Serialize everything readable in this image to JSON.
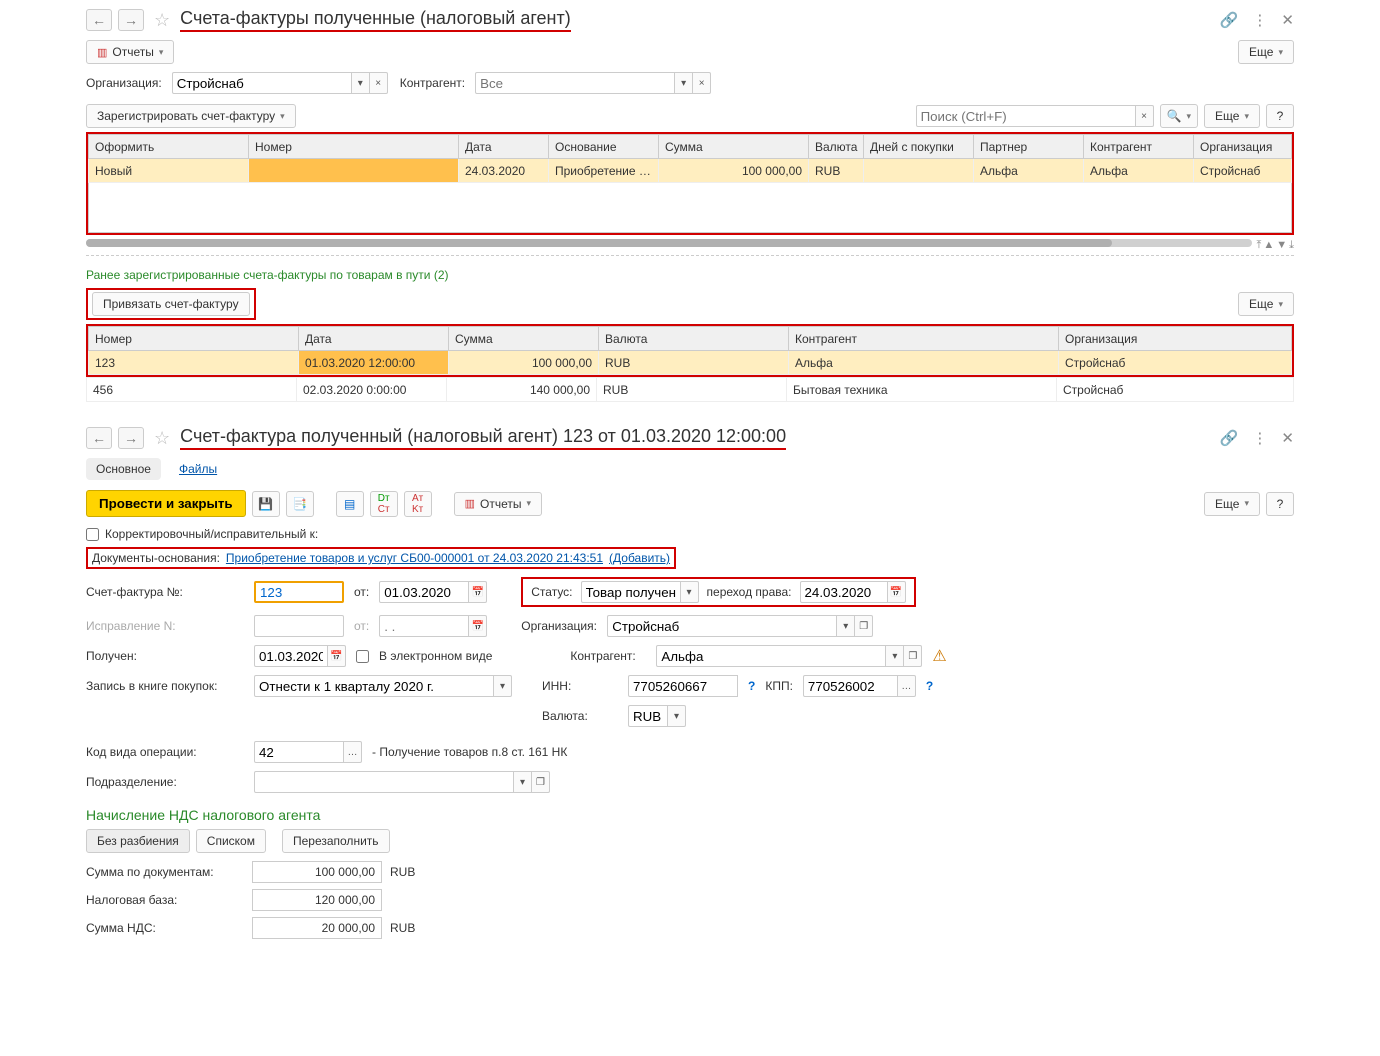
{
  "top": {
    "title": "Счета-фактуры полученные (налоговый агент)",
    "reports_btn": "Отчеты",
    "more_btn": "Еще",
    "org_label": "Организация:",
    "org_value": "Стройснаб",
    "contragent_label": "Контрагент:",
    "contragent_placeholder": "Все",
    "register_btn": "Зарегистрировать счет-фактуру",
    "search_placeholder": "Поиск (Ctrl+F)",
    "help_btn": "?",
    "table1": {
      "cols": [
        "Оформить",
        "Номер",
        "Дата",
        "Основание",
        "Сумма",
        "Валюта",
        "Дней с покупки",
        "Партнер",
        "Контрагент",
        "Организация"
      ],
      "row": {
        "oformit": "Новый",
        "date": "24.03.2020",
        "osnov": "Приобретение т...",
        "sum": "100 000,00",
        "currency": "RUB",
        "partner": "Альфа",
        "contragent": "Альфа",
        "org": "Стройснаб"
      }
    },
    "prev_registered": "Ранее зарегистрированные счета-фактуры по товарам в пути (2)",
    "bind_btn": "Привязать счет-фактуру",
    "table2": {
      "cols": [
        "Номер",
        "Дата",
        "Сумма",
        "Валюта",
        "Контрагент",
        "Организация"
      ],
      "rows": [
        {
          "num": "123",
          "date": "01.03.2020 12:00:00",
          "sum": "100 000,00",
          "cur": "RUB",
          "contr": "Альфа",
          "org": "Стройснаб"
        },
        {
          "num": "456",
          "date": "02.03.2020 0:00:00",
          "sum": "140 000,00",
          "cur": "RUB",
          "contr": "Бытовая техника",
          "org": "Стройснаб"
        }
      ]
    }
  },
  "form": {
    "title": "Счет-фактура полученный (налоговый агент) 123 от 01.03.2020 12:00:00",
    "tab_main": "Основное",
    "tab_files": "Файлы",
    "post_close": "Провести и закрыть",
    "reports_btn": "Отчеты",
    "more_btn": "Еще",
    "help_btn": "?",
    "correction_label": "Корректировочный/исправительный к:",
    "docs_label": "Документы-основания:",
    "docs_link": "Приобретение товаров и услуг СБ00-000001 от 24.03.2020 21:43:51",
    "add_link": "(Добавить)",
    "sf_num_label": "Счет-фактура №:",
    "sf_num_value": "123",
    "from_label": "от:",
    "sf_date": "01.03.2020",
    "status_label": "Статус:",
    "status_value": "Товар получен",
    "transfer_label": "переход права:",
    "transfer_date": "24.03.2020",
    "fix_label": "Исправление N:",
    "org_label": "Организация:",
    "org_value": "Стройснаб",
    "received_label": "Получен:",
    "received_date": "01.03.2020",
    "electronic_label": "В электронном виде",
    "contragent_f_label": "Контрагент:",
    "contragent_f_value": "Альфа",
    "book_label": "Запись в книге покупок:",
    "book_value": "Отнести к 1 кварталу 2020 г.",
    "inn_label": "ИНН:",
    "inn_value": "7705260667",
    "kpp_label": "КПП:",
    "kpp_value": "770526002",
    "currency_label": "Валюта:",
    "currency_value": "RUB",
    "opcode_label": "Код вида операции:",
    "opcode_value": "42",
    "opcode_desc": "- Получение товаров п.8 ст. 161 НК",
    "dept_label": "Подразделение:",
    "nds_title": "Начисление НДС налогового агента",
    "nosplit_btn": "Без разбиения",
    "list_btn": "Списком",
    "refill_btn": "Перезаполнить",
    "sum_docs_label": "Сумма по документам:",
    "sum_docs_value": "100 000,00",
    "sum_docs_cur": "RUB",
    "taxbase_label": "Налоговая база:",
    "taxbase_value": "120 000,00",
    "nds_label": "Сумма НДС:",
    "nds_value": "20 000,00",
    "nds_cur": "RUB"
  }
}
